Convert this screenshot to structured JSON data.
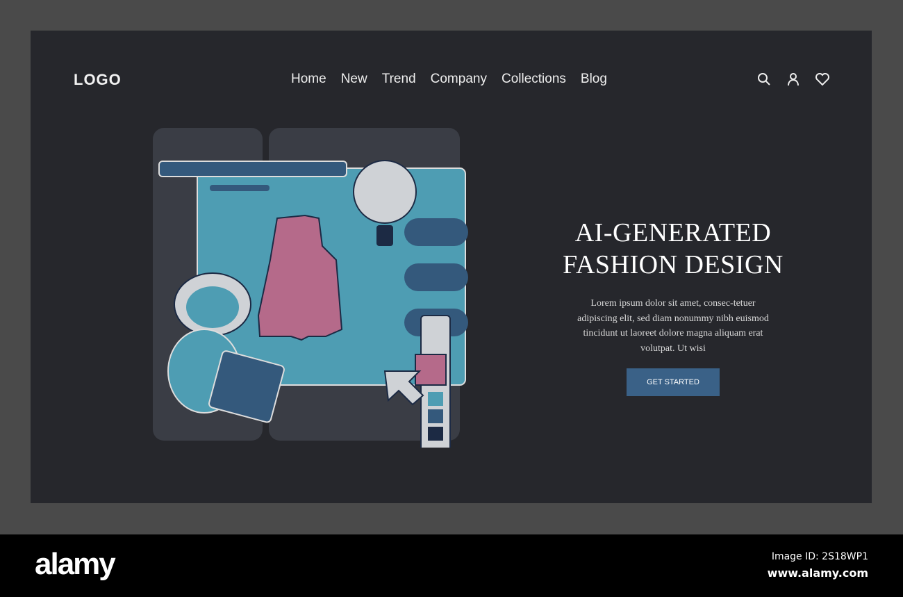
{
  "header": {
    "logo": "LOGO",
    "nav": [
      "Home",
      "New",
      "Trend",
      "Company",
      "Collections",
      "Blog"
    ],
    "icons": [
      "search-icon",
      "user-icon",
      "heart-icon"
    ]
  },
  "hero": {
    "title_line1": "AI-GENERATED",
    "title_line2": "FASHION DESIGN",
    "description": "Lorem ipsum dolor sit amet, consec-tetuer adipiscing elit, sed diam nonummy nibh euismod tincidunt ut laoreet dolore magna aliquam erat volutpat. Ut wisi",
    "cta": "GET STARTED"
  },
  "footer": {
    "brand": "alamy",
    "image_id": "Image ID: 2S18WP1",
    "site": "www.alamy.com"
  },
  "colors": {
    "panel": "#26272c",
    "accent": "#3a6187",
    "teal": "#4a9bb0",
    "cardigan": "#b56a8a"
  }
}
